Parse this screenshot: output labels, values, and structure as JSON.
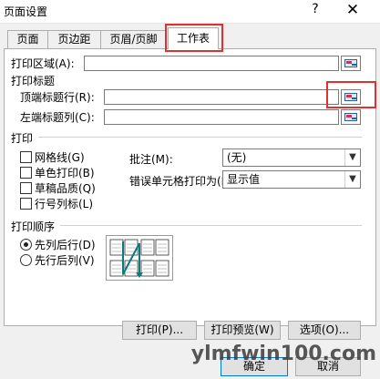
{
  "window": {
    "title": "页面设置",
    "help_label": "?",
    "close_label": "✕"
  },
  "tabs": [
    {
      "label": "页面"
    },
    {
      "label": "页边距"
    },
    {
      "label": "页眉/页脚"
    },
    {
      "label": "工作表"
    }
  ],
  "print_area": {
    "label": "打印区域(A):",
    "value": ""
  },
  "print_titles": {
    "heading": "打印标题",
    "rows_label": "顶端标题行(R):",
    "rows_value": "",
    "cols_label": "左端标题列(C):",
    "cols_value": ""
  },
  "print": {
    "heading": "打印",
    "options": [
      {
        "label": "网格线(G)",
        "checked": false
      },
      {
        "label": "单色打印(B)",
        "checked": false
      },
      {
        "label": "草稿品质(Q)",
        "checked": false
      },
      {
        "label": "行号列标(L)",
        "checked": false
      }
    ],
    "comments_label": "批注(M):",
    "comments_value": "(无)",
    "errors_label": "错误单元格打印为(E):",
    "errors_value": "显示值"
  },
  "page_order": {
    "heading": "打印顺序",
    "options": [
      {
        "label": "先列后行(D)",
        "selected": true
      },
      {
        "label": "先行后列(V)",
        "selected": false
      }
    ]
  },
  "buttons": {
    "print": "打印(P)...",
    "preview": "打印预览(W)",
    "options": "选项(O)...",
    "ok": "确定",
    "cancel": "取消"
  },
  "watermark": "ylmfwin100.com",
  "colors": {
    "highlight": "#e03131",
    "accent": "#0078d7"
  }
}
